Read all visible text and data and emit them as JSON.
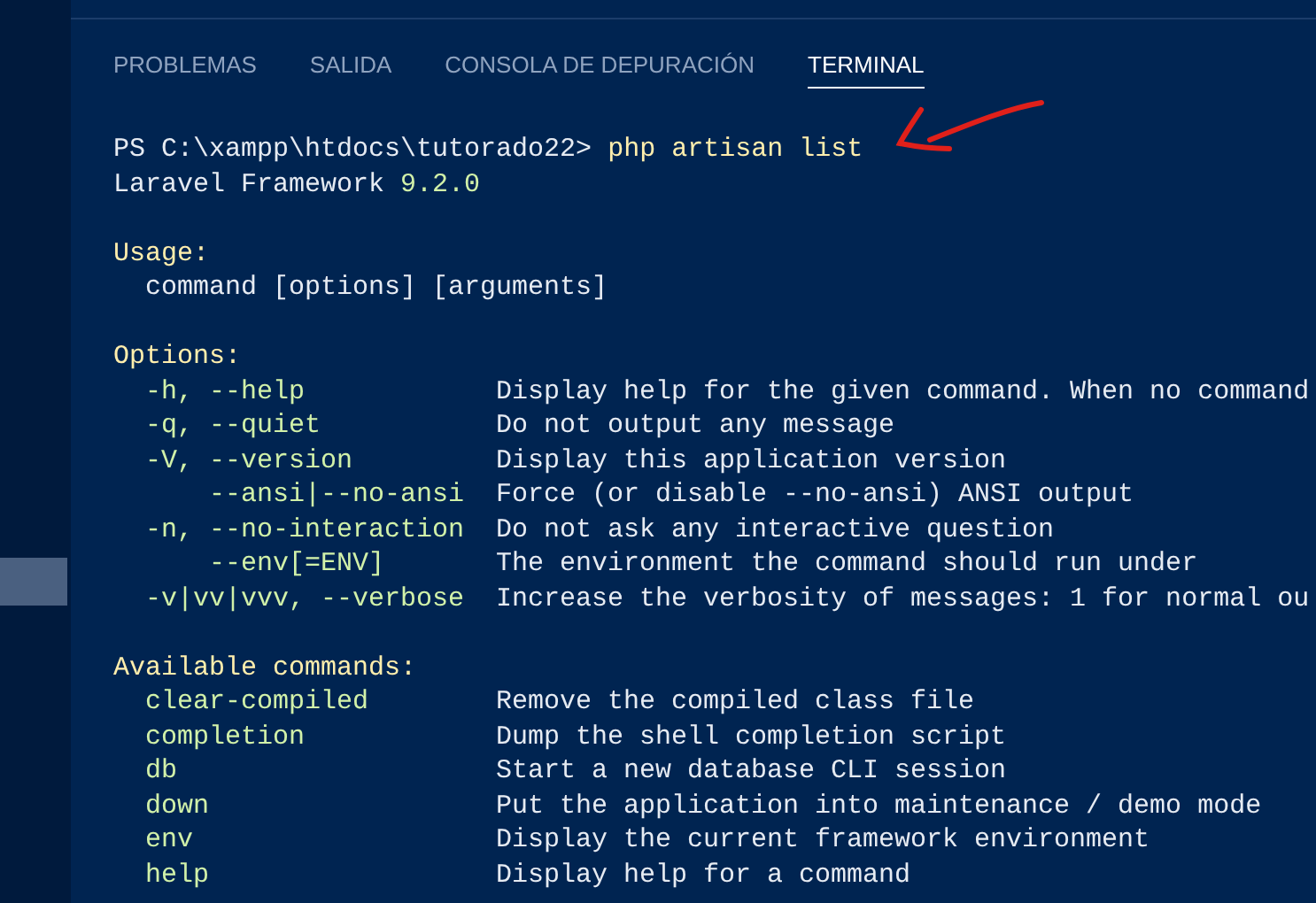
{
  "tabs": [
    {
      "label": "PROBLEMAS",
      "selected": false
    },
    {
      "label": "SALIDA",
      "selected": false
    },
    {
      "label": "CONSOLA DE DEPURACIÓN",
      "selected": false
    },
    {
      "label": "TERMINAL",
      "selected": true
    }
  ],
  "terminal": {
    "prompt": {
      "path": "PS C:\\xampp\\htdocs\\tutorado22>",
      "command": "php artisan list"
    },
    "version_line": {
      "label": "Laravel Framework",
      "version": "9.2.0"
    },
    "usage": {
      "heading": "Usage:",
      "line": "command [options] [arguments]"
    },
    "options": {
      "heading": "Options:",
      "rows": [
        {
          "kind": "short",
          "name": "-h, --help",
          "description": "Display help for the given command. When no command"
        },
        {
          "kind": "short",
          "name": "-q, --quiet",
          "description": "Do not output any message"
        },
        {
          "kind": "short",
          "name": "-V, --version",
          "description": "Display this application version"
        },
        {
          "kind": "long",
          "name": "--ansi|--no-ansi",
          "description": "Force (or disable --no-ansi) ANSI output"
        },
        {
          "kind": "short",
          "name": "-n, --no-interaction",
          "description": "Do not ask any interactive question"
        },
        {
          "kind": "long",
          "name": "--env[=ENV]",
          "description": "The environment the command should run under"
        },
        {
          "kind": "short",
          "name": "-v|vv|vvv, --verbose",
          "description": "Increase the verbosity of messages: 1 for normal ou"
        }
      ]
    },
    "commands": {
      "heading": "Available commands:",
      "rows": [
        {
          "name": "clear-compiled",
          "description": "Remove the compiled class file"
        },
        {
          "name": "completion",
          "description": "Dump the shell completion script"
        },
        {
          "name": "db",
          "description": "Start a new database CLI session"
        },
        {
          "name": "down",
          "description": "Put the application into maintenance / demo mode"
        },
        {
          "name": "env",
          "description": "Display the current framework environment"
        },
        {
          "name": "help",
          "description": "Display help for a command"
        }
      ]
    }
  }
}
